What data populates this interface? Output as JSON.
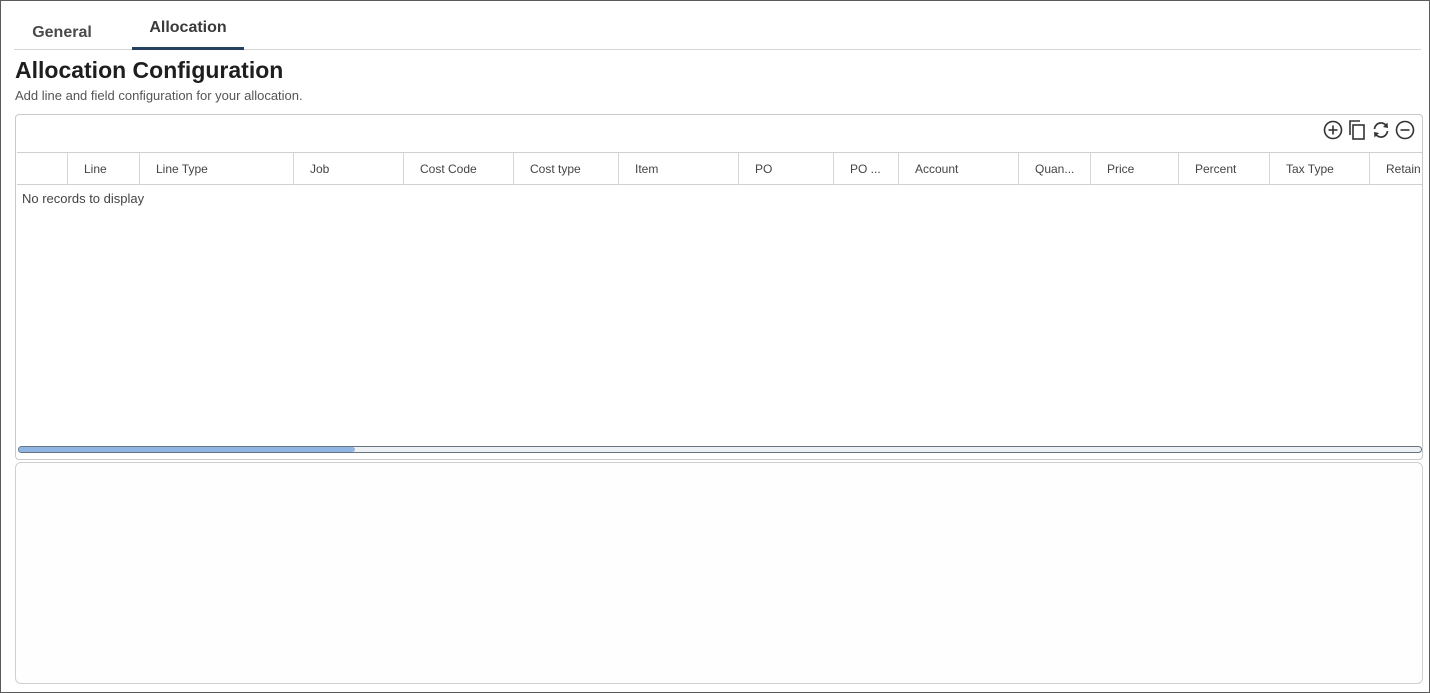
{
  "tabs": [
    {
      "label": "General",
      "active": false
    },
    {
      "label": "Allocation",
      "active": true
    }
  ],
  "page": {
    "title": "Allocation Configuration",
    "subtitle": "Add line and field configuration for your allocation."
  },
  "toolbar": {
    "icons": [
      "add-circle-icon",
      "copy-icon",
      "refresh-icon",
      "remove-circle-icon"
    ]
  },
  "grid": {
    "columns": [
      "",
      "Line",
      "Line Type",
      "Job",
      "Cost Code",
      "Cost type",
      "Item",
      "PO",
      "PO ...",
      "Account",
      "Quan...",
      "Price",
      "Percent",
      "Tax Type",
      "Retain"
    ],
    "empty_message": "No records to display",
    "scroll_fraction": 0.24
  },
  "colors": {
    "active_tab_underline": "#24425e",
    "scroll_thumb": "#8fb6e3"
  }
}
